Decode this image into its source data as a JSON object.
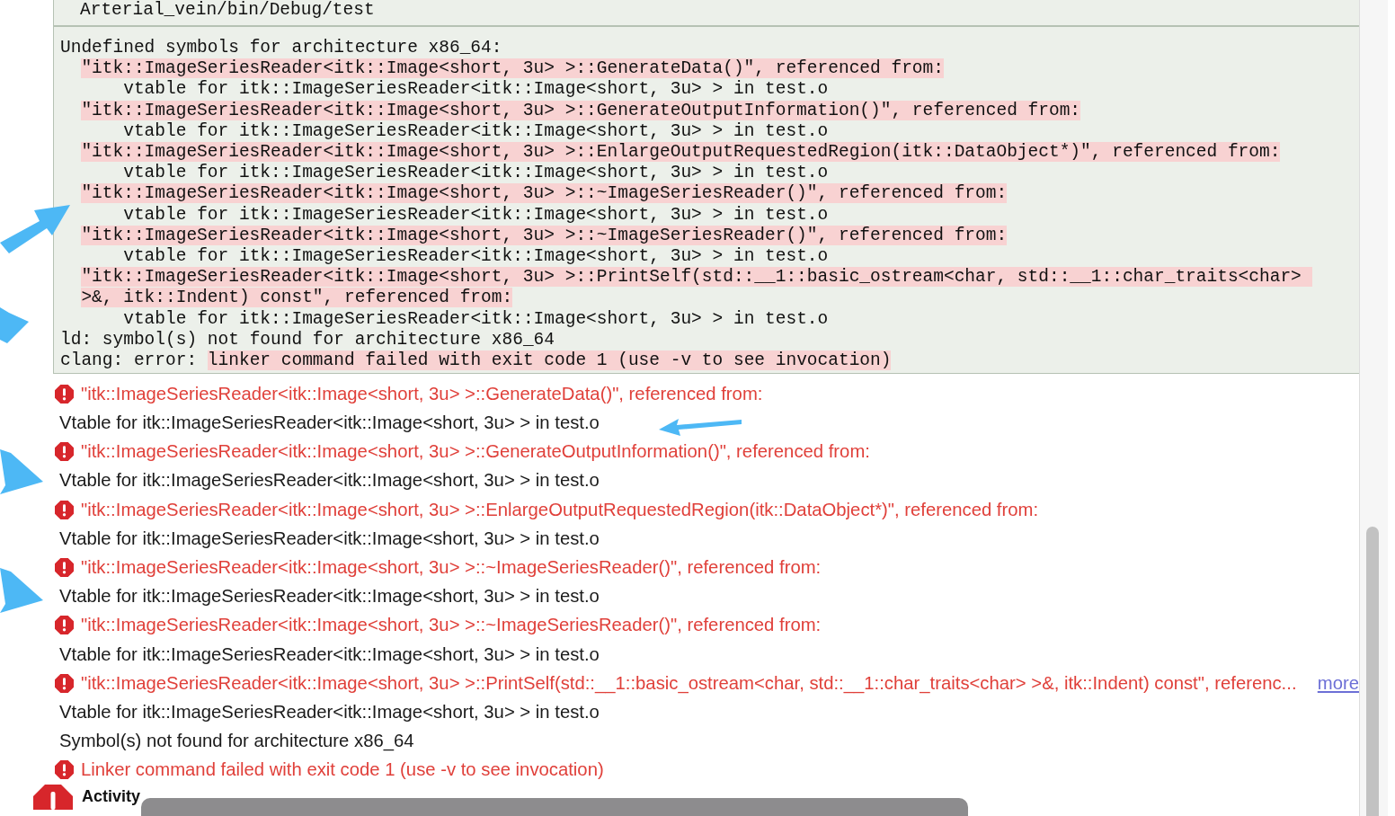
{
  "console": {
    "header": "Arterial_vein/bin/Debug/test",
    "lines": [
      {
        "indented": false,
        "segments": [
          {
            "text": "Undefined symbols for architecture x86_64:",
            "highlighted": false
          }
        ]
      },
      {
        "indented": true,
        "segments": [
          {
            "text": "\"itk::ImageSeriesReader<itk::Image<short, 3u> >::GenerateData()\", referenced from:",
            "highlighted": true
          }
        ]
      },
      {
        "segments": [
          {
            "text": "      vtable for itk::ImageSeriesReader<itk::Image<short, 3u> > in test.o",
            "highlighted": false
          }
        ]
      },
      {
        "indented": true,
        "segments": [
          {
            "text": "\"itk::ImageSeriesReader<itk::Image<short, 3u> >::GenerateOutputInformation()\", referenced from:",
            "highlighted": true
          }
        ]
      },
      {
        "segments": [
          {
            "text": "      vtable for itk::ImageSeriesReader<itk::Image<short, 3u> > in test.o",
            "highlighted": false
          }
        ]
      },
      {
        "indented": true,
        "segments": [
          {
            "text": "\"itk::ImageSeriesReader<itk::Image<short, 3u> >::EnlargeOutputRequestedRegion(itk::DataObject*)\", referenced from:",
            "highlighted": true
          }
        ]
      },
      {
        "segments": [
          {
            "text": "      vtable for itk::ImageSeriesReader<itk::Image<short, 3u> > in test.o",
            "highlighted": false
          }
        ]
      },
      {
        "indented": true,
        "segments": [
          {
            "text": "\"itk::ImageSeriesReader<itk::Image<short, 3u> >::~ImageSeriesReader()\", referenced from:",
            "highlighted": true
          }
        ]
      },
      {
        "segments": [
          {
            "text": "      vtable for itk::ImageSeriesReader<itk::Image<short, 3u> > in test.o",
            "highlighted": false
          }
        ]
      },
      {
        "indented": true,
        "segments": [
          {
            "text": "\"itk::ImageSeriesReader<itk::Image<short, 3u> >::~ImageSeriesReader()\", referenced from:",
            "highlighted": true
          }
        ]
      },
      {
        "segments": [
          {
            "text": "      vtable for itk::ImageSeriesReader<itk::Image<short, 3u> > in test.o",
            "highlighted": false
          }
        ]
      },
      {
        "indented": true,
        "segments": [
          {
            "text": "\"itk::ImageSeriesReader<itk::Image<short, 3u> >::PrintSelf(std::__1::basic_ostream<char, std::__1::char_traits<char> >&, itk::Indent) const\", referenced from:",
            "highlighted": true
          }
        ]
      },
      {
        "segments": [
          {
            "text": "      vtable for itk::ImageSeriesReader<itk::Image<short, 3u> > in test.o",
            "highlighted": false
          }
        ]
      },
      {
        "segments": [
          {
            "text": "ld: symbol(s) not found for architecture x86_64",
            "highlighted": false
          }
        ]
      },
      {
        "segments": [
          {
            "text": "clang: error: ",
            "highlighted": false
          },
          {
            "text": "linker command failed with exit code 1 (use -v to see invocation)",
            "highlighted": true
          }
        ]
      }
    ]
  },
  "issues": [
    {
      "kind": "error",
      "text": "\"itk::ImageSeriesReader<itk::Image<short, 3u> >::GenerateData()\", referenced from:"
    },
    {
      "kind": "note",
      "text": "Vtable for itk::ImageSeriesReader<itk::Image<short, 3u> > in test.o"
    },
    {
      "kind": "error",
      "text": "\"itk::ImageSeriesReader<itk::Image<short, 3u> >::GenerateOutputInformation()\", referenced from:"
    },
    {
      "kind": "note",
      "text": "Vtable for itk::ImageSeriesReader<itk::Image<short, 3u> > in test.o"
    },
    {
      "kind": "error",
      "text": "\"itk::ImageSeriesReader<itk::Image<short, 3u> >::EnlargeOutputRequestedRegion(itk::DataObject*)\", referenced from:"
    },
    {
      "kind": "note",
      "text": "Vtable for itk::ImageSeriesReader<itk::Image<short, 3u> > in test.o"
    },
    {
      "kind": "error",
      "text": "\"itk::ImageSeriesReader<itk::Image<short, 3u> >::~ImageSeriesReader()\", referenced from:"
    },
    {
      "kind": "note",
      "text": "Vtable for itk::ImageSeriesReader<itk::Image<short, 3u> > in test.o"
    },
    {
      "kind": "error",
      "text": "\"itk::ImageSeriesReader<itk::Image<short, 3u> >::~ImageSeriesReader()\", referenced from:"
    },
    {
      "kind": "note",
      "text": "Vtable for itk::ImageSeriesReader<itk::Image<short, 3u> > in test.o"
    },
    {
      "kind": "error",
      "text": "\"itk::ImageSeriesReader<itk::Image<short, 3u> >::PrintSelf(std::__1::basic_ostream<char, std::__1::char_traits<char> >&, itk::Indent) const\", referenc...",
      "link": "more"
    },
    {
      "kind": "note",
      "text": "Vtable for itk::ImageSeriesReader<itk::Image<short, 3u> > in test.o"
    },
    {
      "kind": "note",
      "text": "Symbol(s) not found for architecture x86_64"
    },
    {
      "kind": "error",
      "text": "Linker command failed with exit code 1 (use -v to see invocation)"
    }
  ],
  "activity": {
    "text": "Activity"
  }
}
